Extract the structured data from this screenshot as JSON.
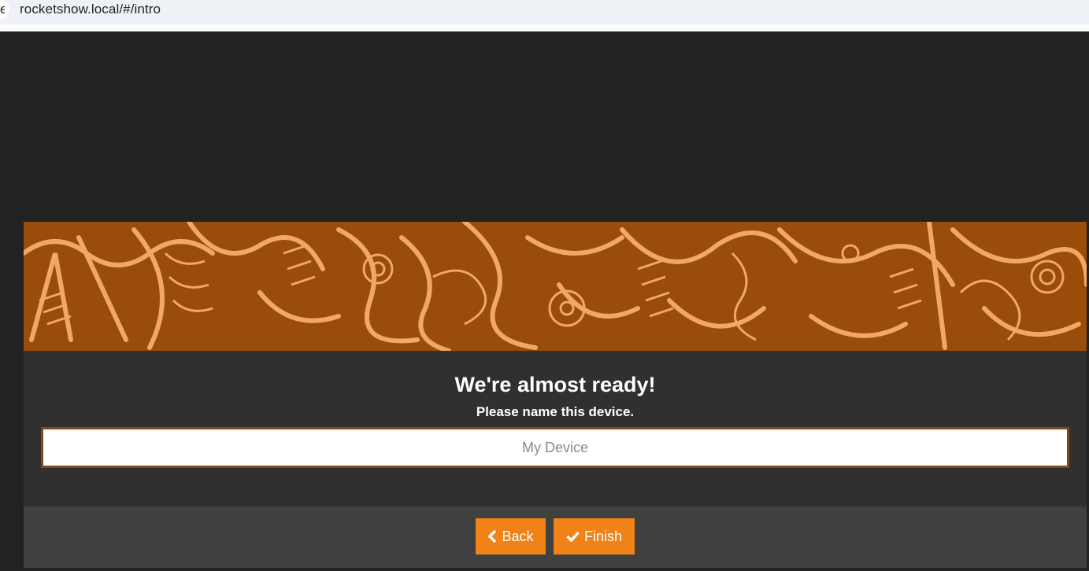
{
  "browser": {
    "url": "rocketshow.local/#/intro",
    "tab_fragment": "e"
  },
  "dialog": {
    "title": "We're almost ready!",
    "subtitle": "Please name this device.",
    "name_input": {
      "value": "",
      "placeholder": "My Device"
    },
    "buttons": {
      "back_label": "Back",
      "finish_label": "Finish"
    },
    "banner": {
      "icon": "decorative-doodle-pattern",
      "color_bg": "#9a4d0a",
      "color_line": "#f2a765"
    }
  },
  "colors": {
    "accent": "#f08218",
    "page_bg": "#222222",
    "dialog_bg": "#303030",
    "footer_bg": "#404040",
    "input_border": "#7a4a22"
  }
}
